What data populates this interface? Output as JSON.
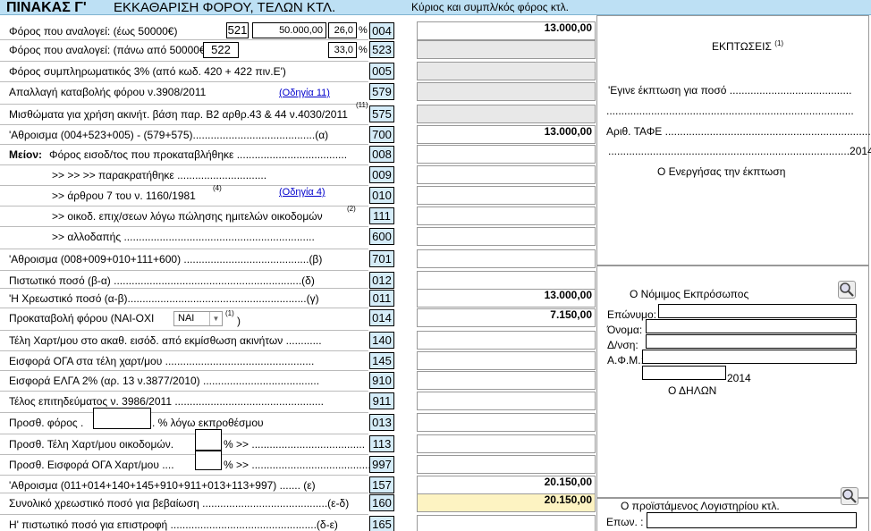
{
  "header": {
    "title": "ΠΙΝΑΚΑΣ Γ'",
    "subtitle": "ΕΚΚΑΘΑΡΙΣΗ ΦΟΡΟΥ, ΤΕΛΩΝ ΚΤΛ.",
    "right": "Κύριος και συμπλ/κός φόρος κτλ."
  },
  "rows": [
    {
      "label": "Φόρος που αναλογεί: (έως 50000€)",
      "code": "004",
      "value": "13.000,00"
    },
    {
      "label": "Φόρος που αναλογεί: (πάνω από 50000€)",
      "code": "523",
      "value": ""
    },
    {
      "label": "Φόρος συμπληρωματικός 3% (από κωδ. 420 + 422 πιν.Ε')",
      "code": "005",
      "value": ""
    },
    {
      "label": "Απαλλαγή καταβολής φόρου ν.3908/2011",
      "code": "579",
      "value": ""
    },
    {
      "label": "Μισθώματα για χρήση ακινήτ. βάση παρ. Β2 αρθρ.43 & 44 ν.4030/2011",
      "code": "575",
      "value": ""
    },
    {
      "label": "'Αθροισμα (004+523+005) - (579+575).........................................(α)",
      "code": "700",
      "value": "13.000,00"
    },
    {
      "label": "Φόρος εισοδ/τος που προκαταβλήθηκε .....................................",
      "code": "008",
      "value": ""
    },
    {
      "label": ">>          >>     >> παρακρατήθηκε ..............................",
      "code": "009",
      "value": ""
    },
    {
      "label": ">>  άρθρου 7 του ν. 1160/1981",
      "code": "010",
      "value": ""
    },
    {
      "label": ">> οικοδ. επιχ/σεων λόγω πώλησης ημιτελών οικοδομών",
      "code": "111",
      "value": ""
    },
    {
      "label": ">> αλλοδαπής ................................................................",
      "code": "600",
      "value": ""
    },
    {
      "label": "'Αθροισμα (008+009+010+111+600) ..........................................(β)",
      "code": "701",
      "value": ""
    },
    {
      "label": "Πιστωτικό ποσό (β-α) ...............................................................(δ)",
      "code": "012",
      "value": ""
    },
    {
      "label": "'Η Χρεωστικό ποσό (α-β)............................................................(γ)",
      "code": "011",
      "value": "13.000,00"
    },
    {
      "label": "Προκαταβολή φόρου (ΝΑΙ-ΟΧΙ",
      "code": "014",
      "value": "7.150,00"
    },
    {
      "label": "Τέλη Χαρτ/μου στο ακαθ. εισόδ. από εκμίσθωση ακινήτων  ............",
      "code": "140",
      "value": ""
    },
    {
      "label": "Εισφορά ΟΓΑ στα τέλη χαρτ/μου ..................................................",
      "code": "145",
      "value": ""
    },
    {
      "label": "Εισφορά ΕΛΓΑ 2% (αρ. 13 ν.3877/2010) .......................................",
      "code": "910",
      "value": ""
    },
    {
      "label": "Τέλος επιτηδεύματος ν. 3986/2011 ..................................................",
      "code": "911",
      "value": ""
    },
    {
      "label": "Προσθ. φόρος .",
      "code": "013",
      "value": ""
    },
    {
      "label": "Προσθ. Τέλη Χαρτ/μου οικοδομών.",
      "code": "113",
      "value": ""
    },
    {
      "label": "Προσθ. Εισφορά ΟΓΑ  Χαρτ/μου ....",
      "code": "997",
      "value": ""
    },
    {
      "label": "'Αθροισμα (011+014+140+145+910+911+013+113+997) ....... (ε)",
      "code": "157",
      "value": "20.150,00"
    },
    {
      "label": "Συνολικό χρεωστικό ποσό για βεβαίωση ..........................................(ε-δ)",
      "code": "160",
      "value": "20.150,00"
    },
    {
      "label": "Η' πιστωτικό ποσό για επιστροφή .................................................(δ-ε)",
      "code": "165",
      "value": ""
    }
  ],
  "meion": "Μείον:",
  "f521": {
    "code": "521",
    "amount": "50.000,00",
    "pct": "26,0",
    "pctsign": "%"
  },
  "f522": {
    "code": "522",
    "pct": "33,0",
    "pctsign": "%"
  },
  "links": {
    "odigia11": "(Οδηγία 11)",
    "odigia4": "(Οδηγία 4)"
  },
  "sups": {
    "s11": "(11)",
    "s4": "(4)",
    "s2": "(2)",
    "s1": "(1)"
  },
  "prokat": {
    "select": "ΝΑΙ",
    "tail": ")"
  },
  "pct_labels": {
    "foros": ". % λόγω εκπροθέσμου",
    "xart": "% >> ......................................",
    "oga": "% >> ........................................"
  },
  "right": {
    "ekptoseis": "ΕΚΠΤΩΣΕΙΣ",
    "line1": "'Εγινε έκπτωση για ποσό .........................................",
    "line2": "...................................................................................",
    "line3": "Αριθ. ΤΑΦΕ ......................................................................",
    "line4": ".................................................................................2014",
    "line5": "Ο Ενεργήσας την έκπτωση",
    "rep_title": "Ο Νόμιμος Εκπρόσωπος",
    "f_eponymo": "Επώνυμο:",
    "f_onoma": "Όνομα:",
    "f_dnsi": "Δ/νση:",
    "f_afm": "Α.Φ.Μ.:",
    "year": "2014",
    "dilon": "Ο ΔΗΛΩΝ",
    "proist": "Ο προϊστάμενος Λογιστηρίου κτλ.",
    "epon2": "Επων. :"
  }
}
